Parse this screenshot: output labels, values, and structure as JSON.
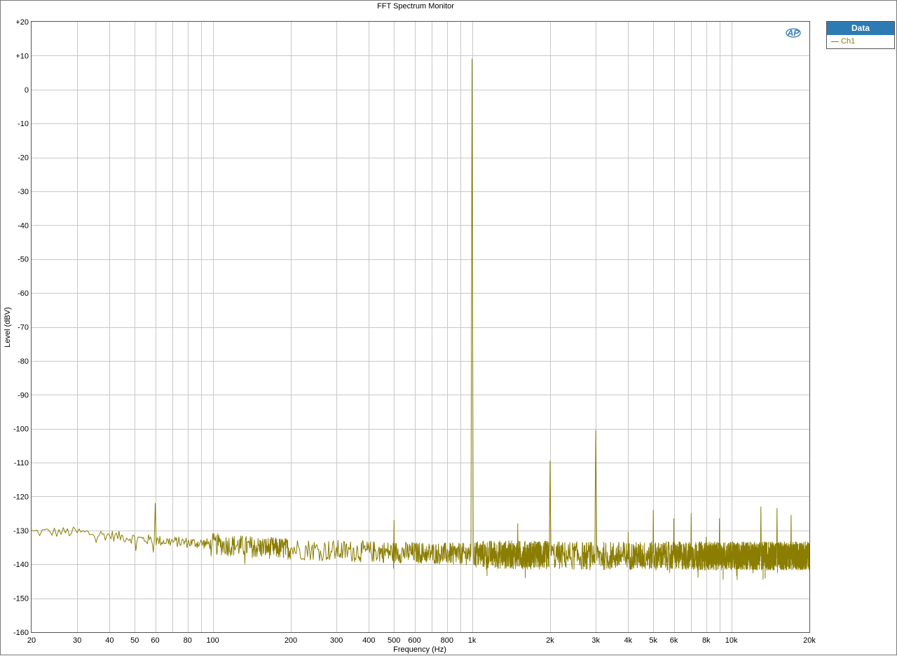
{
  "colors": {
    "series": "#8a7d00",
    "grid": "#c8c8c8",
    "legend_header": "#2e7bb3",
    "logo": "#2e7bb3"
  },
  "logo_text": "AP",
  "legend": {
    "title": "Data",
    "items": [
      "Ch1"
    ]
  },
  "chart_data": {
    "type": "line",
    "title": "FFT Spectrum Monitor",
    "xlabel": "Frequency (Hz)",
    "ylabel": "Level (dBV)",
    "xscale": "log",
    "xlim": [
      20,
      20000
    ],
    "ylim": [
      -160,
      20
    ],
    "grid": true,
    "legend_position": "right-outside-top",
    "x_ticks": [
      {
        "value": 20,
        "label": "20"
      },
      {
        "value": 30,
        "label": "30"
      },
      {
        "value": 40,
        "label": "40"
      },
      {
        "value": 50,
        "label": "50"
      },
      {
        "value": 60,
        "label": "60"
      },
      {
        "value": 80,
        "label": "80"
      },
      {
        "value": 100,
        "label": "100"
      },
      {
        "value": 200,
        "label": "200"
      },
      {
        "value": 300,
        "label": "300"
      },
      {
        "value": 400,
        "label": "400"
      },
      {
        "value": 500,
        "label": "500"
      },
      {
        "value": 600,
        "label": "600"
      },
      {
        "value": 800,
        "label": "800"
      },
      {
        "value": 1000,
        "label": "1k"
      },
      {
        "value": 2000,
        "label": "2k"
      },
      {
        "value": 3000,
        "label": "3k"
      },
      {
        "value": 4000,
        "label": "4k"
      },
      {
        "value": 5000,
        "label": "5k"
      },
      {
        "value": 6000,
        "label": "6k"
      },
      {
        "value": 8000,
        "label": "8k"
      },
      {
        "value": 10000,
        "label": "10k"
      },
      {
        "value": 20000,
        "label": "20k"
      }
    ],
    "x_minor_grid": [
      70,
      90,
      700,
      900,
      7000,
      9000
    ],
    "y_ticks": [
      {
        "value": 20,
        "label": "+20"
      },
      {
        "value": 10,
        "label": "+10"
      },
      {
        "value": 0,
        "label": "0"
      },
      {
        "value": -10,
        "label": "-10"
      },
      {
        "value": -20,
        "label": "-20"
      },
      {
        "value": -30,
        "label": "-30"
      },
      {
        "value": -40,
        "label": "-40"
      },
      {
        "value": -50,
        "label": "-50"
      },
      {
        "value": -60,
        "label": "-60"
      },
      {
        "value": -70,
        "label": "-70"
      },
      {
        "value": -80,
        "label": "-80"
      },
      {
        "value": -90,
        "label": "-90"
      },
      {
        "value": -100,
        "label": "-100"
      },
      {
        "value": -110,
        "label": "-110"
      },
      {
        "value": -120,
        "label": "-120"
      },
      {
        "value": -130,
        "label": "-130"
      },
      {
        "value": -140,
        "label": "-140"
      },
      {
        "value": -150,
        "label": "-150"
      },
      {
        "value": -160,
        "label": "-160"
      }
    ],
    "series": [
      {
        "name": "Ch1",
        "noise_floor": {
          "x": [
            20,
            30,
            40,
            60,
            100,
            150,
            300,
            1000,
            3000,
            20000
          ],
          "y": [
            -130.5,
            -130.5,
            -131.5,
            -133,
            -134,
            -135,
            -136,
            -137,
            -137.5,
            -137.5
          ]
        },
        "peaks": [
          {
            "x": 60,
            "y": -122
          },
          {
            "x": 500,
            "y": -127
          },
          {
            "x": 1000,
            "y": 9
          },
          {
            "x": 1500,
            "y": -128
          },
          {
            "x": 2000,
            "y": -109.5
          },
          {
            "x": 3000,
            "y": -100.5
          },
          {
            "x": 4000,
            "y": -130.5
          },
          {
            "x": 5000,
            "y": -124
          },
          {
            "x": 6000,
            "y": -126.5
          },
          {
            "x": 7000,
            "y": -125
          },
          {
            "x": 8000,
            "y": -132
          },
          {
            "x": 9000,
            "y": -126.5
          },
          {
            "x": 13000,
            "y": -123
          },
          {
            "x": 15000,
            "y": -123.5
          },
          {
            "x": 17000,
            "y": -125.5
          }
        ]
      }
    ]
  }
}
